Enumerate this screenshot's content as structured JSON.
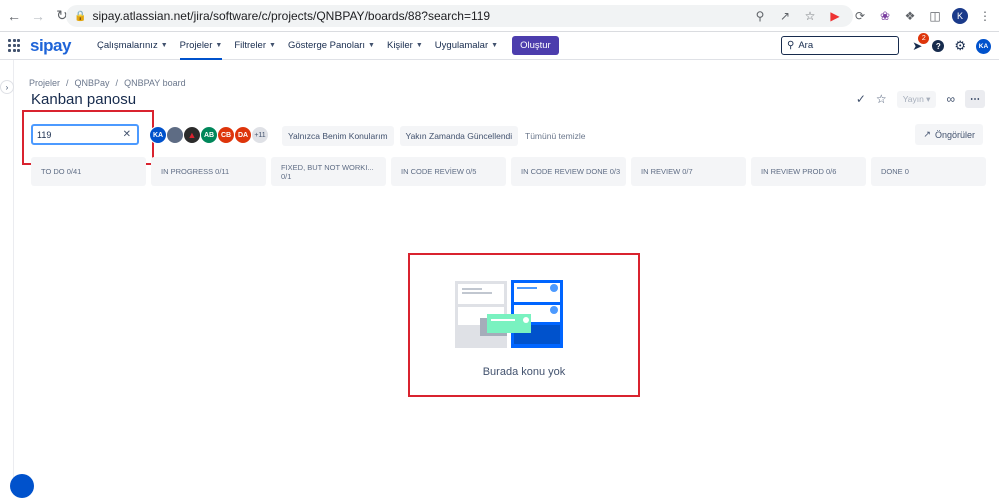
{
  "browser": {
    "url": "sipay.atlassian.net/jira/software/c/projects/QNBPAY/boards/88?search=119",
    "profile_initial": "K"
  },
  "nav": {
    "logo": "sipay",
    "menu": [
      {
        "label": "Çalışmalarınız"
      },
      {
        "label": "Projeler"
      },
      {
        "label": "Filtreler"
      },
      {
        "label": "Gösterge Panoları"
      },
      {
        "label": "Kişiler"
      },
      {
        "label": "Uygulamalar"
      }
    ],
    "create_label": "Oluştur",
    "search_placeholder": "Ara",
    "notifications_count": "2",
    "help_label": "?",
    "user_initials": "KA"
  },
  "breadcrumb": [
    "Projeler",
    "QNBPay",
    "QNBPAY board"
  ],
  "page_title": "Kanban panosu",
  "publish_label": "Yayın",
  "filter": {
    "search_value": "119",
    "avatars": [
      {
        "initials": "KA",
        "color": "#0052cc"
      },
      {
        "initials": "",
        "color": "#5e6c84"
      },
      {
        "initials": "",
        "color": "#2b2b2b"
      },
      {
        "initials": "AB",
        "color": "#00875a"
      },
      {
        "initials": "CB",
        "color": "#de350b"
      },
      {
        "initials": "DA",
        "color": "#de350b"
      },
      {
        "initials": "+11",
        "color": "#dfe1e6"
      }
    ],
    "quick_filters": [
      "Yalnızca Benim Konularım",
      "Yakın Zamanda Güncellendi"
    ],
    "clear_all": "Tümünü temizle",
    "insights": "Öngörüler"
  },
  "columns": [
    "TO DO 0/41",
    "IN PROGRESS 0/11",
    "FIXED, BUT NOT WORKI... 0/1",
    "IN CODE REVİEW 0/5",
    "IN CODE REVIEW DONE 0/3",
    "IN REVIEW 0/7",
    "IN REVIEW PROD 0/6",
    "DONE 0"
  ],
  "empty_state": "Burada konu yok",
  "colors": {
    "brand": "#1e64d8",
    "create": "#4c3dad",
    "highlight": "#d9232f",
    "focus": "#4c9aff"
  }
}
